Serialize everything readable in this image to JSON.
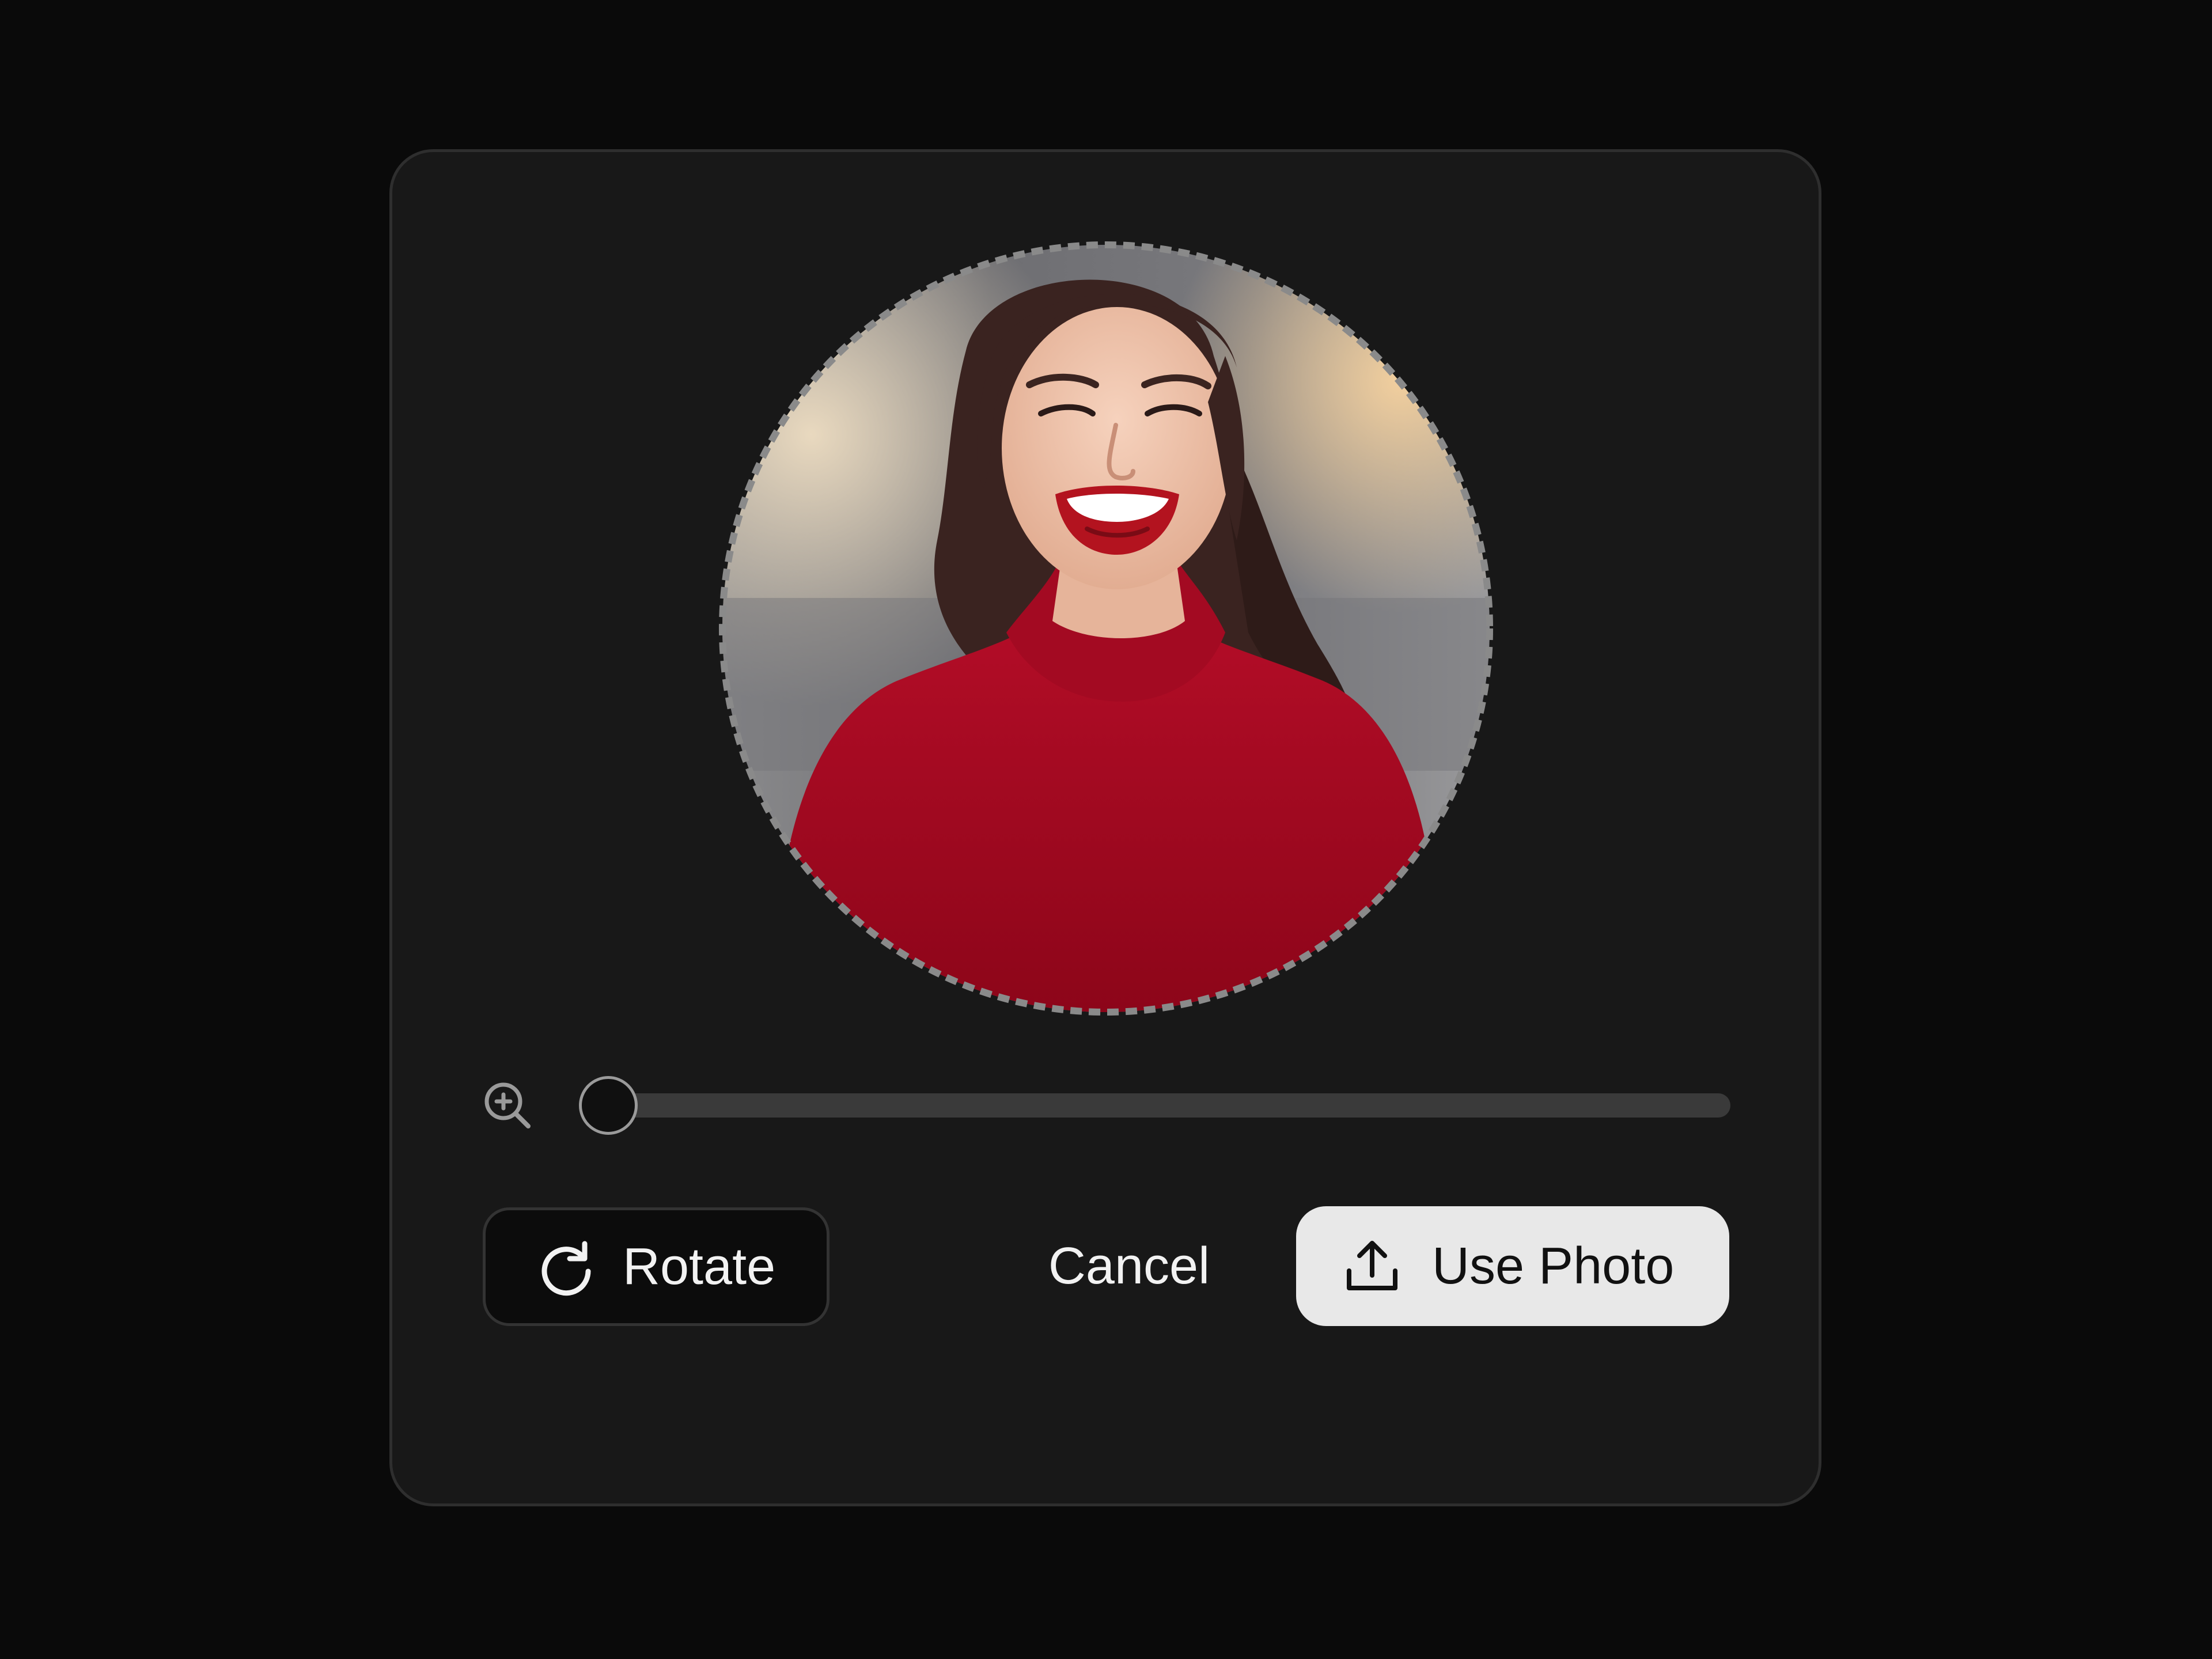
{
  "dialog": {
    "photo": {
      "subject": "smiling woman with dark wavy hair wearing a red mock-neck top",
      "crop_shape": "circle"
    },
    "zoom": {
      "icon": "zoom-in-icon",
      "level": 0.0
    },
    "actions": {
      "rotate_label": "Rotate",
      "rotate_icon": "rotate-clockwise-icon",
      "cancel_label": "Cancel",
      "use_photo_label": "Use Photo",
      "use_photo_icon": "upload-icon"
    }
  },
  "colors": {
    "page_background": "#0a0a0a",
    "card_background": "#181818",
    "card_border": "#2e2e2e",
    "primary_button": "#e8e8e8",
    "shirt_red": "#a4071f"
  }
}
